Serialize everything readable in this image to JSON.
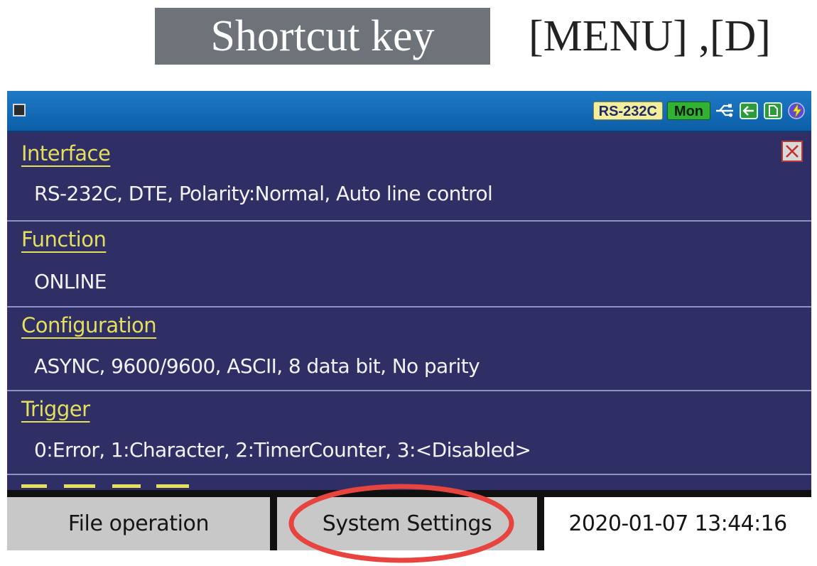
{
  "caption": {
    "label": "Shortcut key",
    "keys": "[MENU] ,[D]"
  },
  "titlebar": {
    "status_badges": {
      "port": "RS-232C",
      "mode": "Mon"
    },
    "status_icons": [
      "usb-icon",
      "arrow-left-icon",
      "document-icon",
      "battery-icon"
    ]
  },
  "sections": [
    {
      "title": "Interface",
      "value": "RS-232C, DTE, Polarity:Normal, Auto line control"
    },
    {
      "title": "Function",
      "value": "ONLINE"
    },
    {
      "title": "Configuration",
      "value": "ASYNC, 9600/9600, ASCII, 8 data bit, No parity"
    },
    {
      "title": "Trigger",
      "value": "0:Error, 1:Character, 2:TimerCounter, 3:<Disabled>"
    }
  ],
  "bottombar": {
    "file_operation": "File operation",
    "system_settings": "System Settings",
    "datetime": "2020-01-07 13:44:16"
  },
  "colors": {
    "screen_background": "#2f2f66",
    "titlebar": "#0c5ea9",
    "section_title": "#e4df5c",
    "highlight": "#e8443f"
  }
}
